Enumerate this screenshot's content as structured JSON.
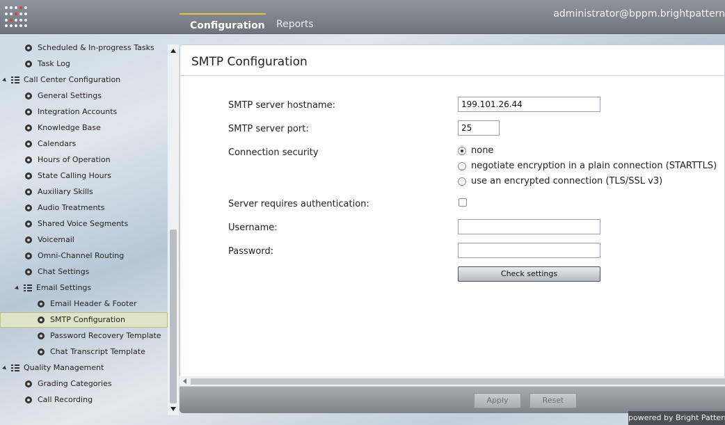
{
  "header": {
    "tabs": [
      {
        "label": "Configuration",
        "active": true
      },
      {
        "label": "Reports",
        "active": false
      }
    ],
    "user": "administrator@bppm.brightpattern"
  },
  "sidebar": {
    "items": [
      {
        "label": "Scheduled & In-progress Tasks",
        "type": "leaf",
        "level": 1
      },
      {
        "label": "Task Log",
        "type": "leaf",
        "level": 1
      },
      {
        "label": "Call Center Configuration",
        "type": "folder",
        "level": 0
      },
      {
        "label": "General Settings",
        "type": "leaf",
        "level": 1
      },
      {
        "label": "Integration Accounts",
        "type": "leaf",
        "level": 1
      },
      {
        "label": "Knowledge Base",
        "type": "leaf",
        "level": 1
      },
      {
        "label": "Calendars",
        "type": "leaf",
        "level": 1
      },
      {
        "label": "Hours of Operation",
        "type": "leaf",
        "level": 1
      },
      {
        "label": "State Calling Hours",
        "type": "leaf",
        "level": 1
      },
      {
        "label": "Auxiliary Skills",
        "type": "leaf",
        "level": 1
      },
      {
        "label": "Audio Treatments",
        "type": "leaf",
        "level": 1
      },
      {
        "label": "Shared Voice Segments",
        "type": "leaf",
        "level": 1
      },
      {
        "label": "Voicemail",
        "type": "leaf",
        "level": 1
      },
      {
        "label": "Omni-Channel Routing",
        "type": "leaf",
        "level": 1
      },
      {
        "label": "Chat Settings",
        "type": "leaf",
        "level": 1
      },
      {
        "label": "Email Settings",
        "type": "folder",
        "level": 1
      },
      {
        "label": "Email Header & Footer",
        "type": "leaf",
        "level": 2
      },
      {
        "label": "SMTP Configuration",
        "type": "leaf",
        "level": 2,
        "selected": true
      },
      {
        "label": "Password Recovery Template",
        "type": "leaf",
        "level": 2
      },
      {
        "label": "Chat Transcript Template",
        "type": "leaf",
        "level": 2
      },
      {
        "label": "Quality Management",
        "type": "folder",
        "level": 0
      },
      {
        "label": "Grading Categories",
        "type": "leaf",
        "level": 1
      },
      {
        "label": "Call Recording",
        "type": "leaf",
        "level": 1
      }
    ]
  },
  "main": {
    "title": "SMTP Configuration",
    "hostname_label": "SMTP server hostname:",
    "hostname_value": "199.101.26.44",
    "port_label": "SMTP server port:",
    "port_value": "25",
    "security_label": "Connection security",
    "security_options": [
      {
        "label": "none",
        "checked": true
      },
      {
        "label": "negotiate encryption in a plain connection (STARTTLS)",
        "checked": false
      },
      {
        "label": "use an encrypted connection (TLS/SSL v3)",
        "checked": false
      }
    ],
    "auth_label": "Server requires authentication:",
    "auth_checked": false,
    "username_label": "Username:",
    "username_value": "",
    "password_label": "Password:",
    "password_value": "",
    "check_button": "Check settings"
  },
  "footer": {
    "apply": "Apply",
    "reset": "Reset",
    "powered_by": "powered by Bright Pattern"
  }
}
